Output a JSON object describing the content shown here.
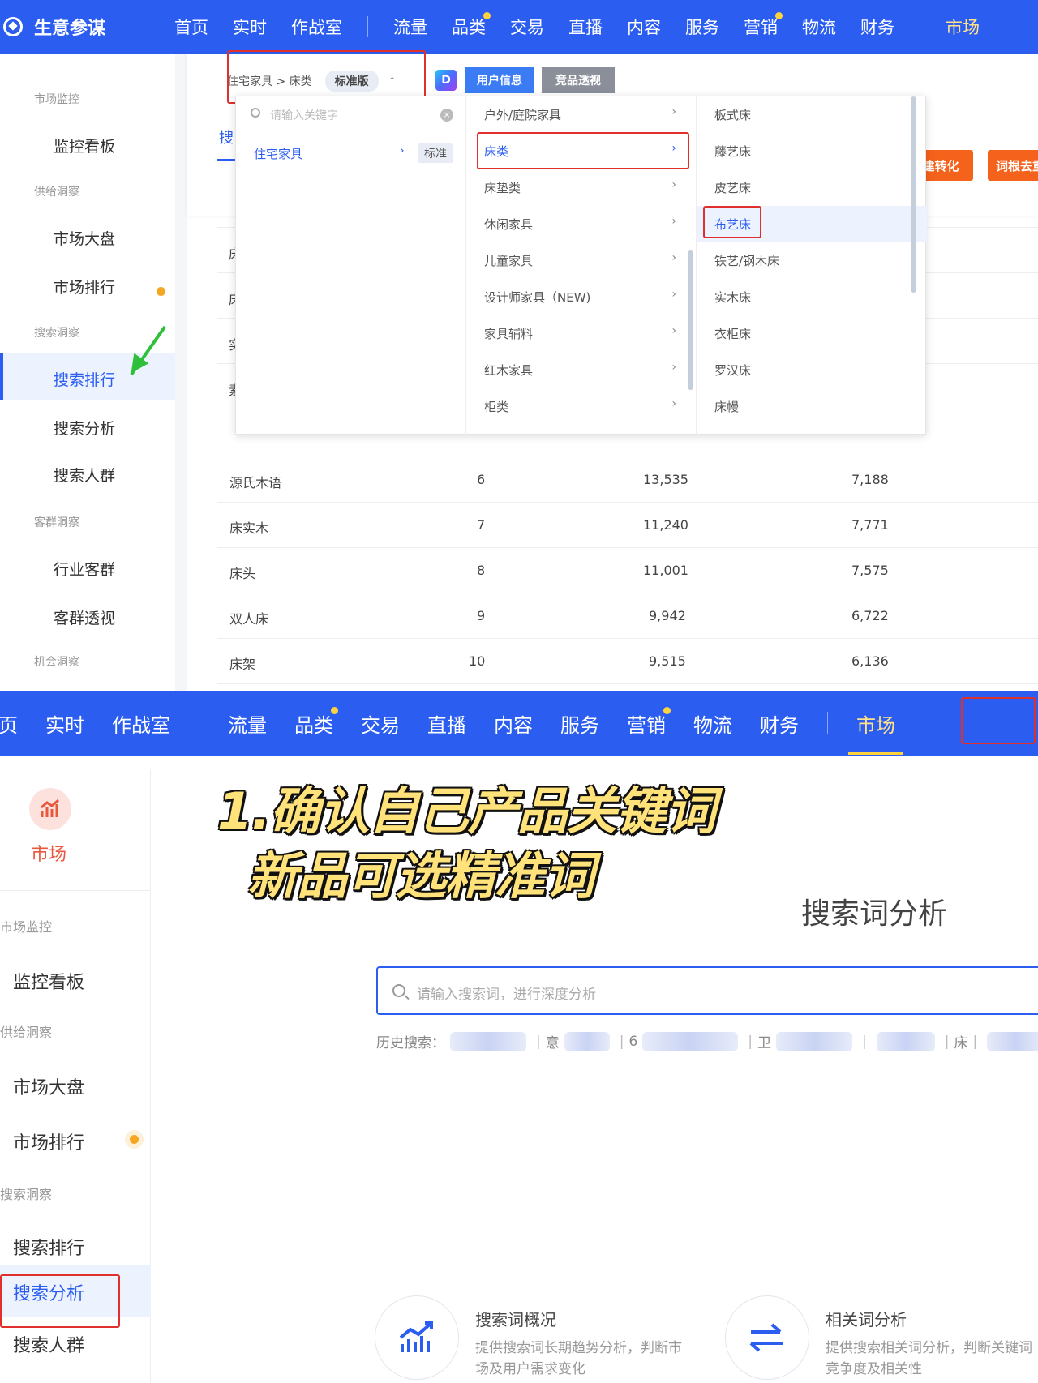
{
  "panel1": {
    "app_title": "生意参谋",
    "nav": [
      "首页",
      "实时",
      "作战室",
      "流量",
      "品类",
      "交易",
      "直播",
      "内容",
      "服务",
      "营销",
      "物流",
      "财务",
      "市场"
    ],
    "sidebar": {
      "groups": [
        "市场监控",
        "供给洞察",
        "搜索洞察",
        "客群洞察",
        "机会洞察"
      ],
      "items": [
        "监控看板",
        "市场大盘",
        "市场排行",
        "搜索排行",
        "搜索分析",
        "搜索人群",
        "行业客群",
        "客群透视"
      ]
    },
    "breadcrumb": "住宅家具 > 床类",
    "version_tag": "标准版",
    "tags": [
      "用户信息",
      "竞品透视"
    ],
    "tab_partial": "搜",
    "buttons": [
      "建转化",
      "词根去重"
    ],
    "dropdown": {
      "search_placeholder": "请输入关键字",
      "col1": [
        {
          "label": "住宅家具",
          "tag": "标准"
        }
      ],
      "col2": [
        "户外/庭院家具",
        "床类",
        "床垫类",
        "休闲家具",
        "儿童家具",
        "设计师家具（NEW)",
        "家具辅料",
        "红木家具",
        "柜类"
      ],
      "col3": [
        "板式床",
        "藤艺床",
        "皮艺床",
        "布艺床",
        "铁艺/钢木床",
        "实木床",
        "衣柜床",
        "罗汉床",
        "床幔"
      ]
    },
    "table_rows": [
      {
        "word": "源氏木语",
        "rank": "6",
        "v1": "13,535",
        "v2": "7,188"
      },
      {
        "word": "床实木",
        "rank": "7",
        "v1": "11,240",
        "v2": "7,771"
      },
      {
        "word": "床头",
        "rank": "8",
        "v1": "11,001",
        "v2": "7,575"
      },
      {
        "word": "双人床",
        "rank": "9",
        "v1": "9,942",
        "v2": "6,722"
      },
      {
        "word": "床架",
        "rank": "10",
        "v1": "9,515",
        "v2": "6,136"
      }
    ],
    "partial_rows": [
      "床",
      "床",
      "实",
      "素"
    ]
  },
  "panel2": {
    "nav": [
      "页",
      "实时",
      "作战室",
      "流量",
      "品类",
      "交易",
      "直播",
      "内容",
      "服务",
      "营销",
      "物流",
      "财务",
      "市场"
    ],
    "market_label": "市场",
    "sidebar": {
      "groups": [
        "市场监控",
        "供给洞察",
        "搜索洞察"
      ],
      "items": [
        "监控看板",
        "市场大盘",
        "市场排行",
        "搜索排行",
        "搜索分析",
        "搜索人群"
      ]
    },
    "caption_line1": "1.确认自己产品关键词",
    "caption_line2": "新品可选精准词",
    "page_title": "搜索词分析",
    "search_placeholder": "请输入搜索词，进行深度分析",
    "history_label": "历史搜索：",
    "history_partial": [
      "意",
      "6",
      "卫",
      "床"
    ],
    "features": [
      {
        "title": "搜索词概况",
        "desc": "提供搜索词长期趋势分析，判断市场及用户需求变化",
        "icon": "trend-chart-icon"
      },
      {
        "title": "相关词分析",
        "desc": "提供搜索相关词分析，判断关键词竞争度及相关性",
        "icon": "swap-arrows-icon"
      }
    ]
  },
  "colors": {
    "nav_blue": "#2b5ef0",
    "highlight_red": "#e0302b",
    "orange": "#f5621b",
    "caption_yellow": "#ffe27a"
  }
}
